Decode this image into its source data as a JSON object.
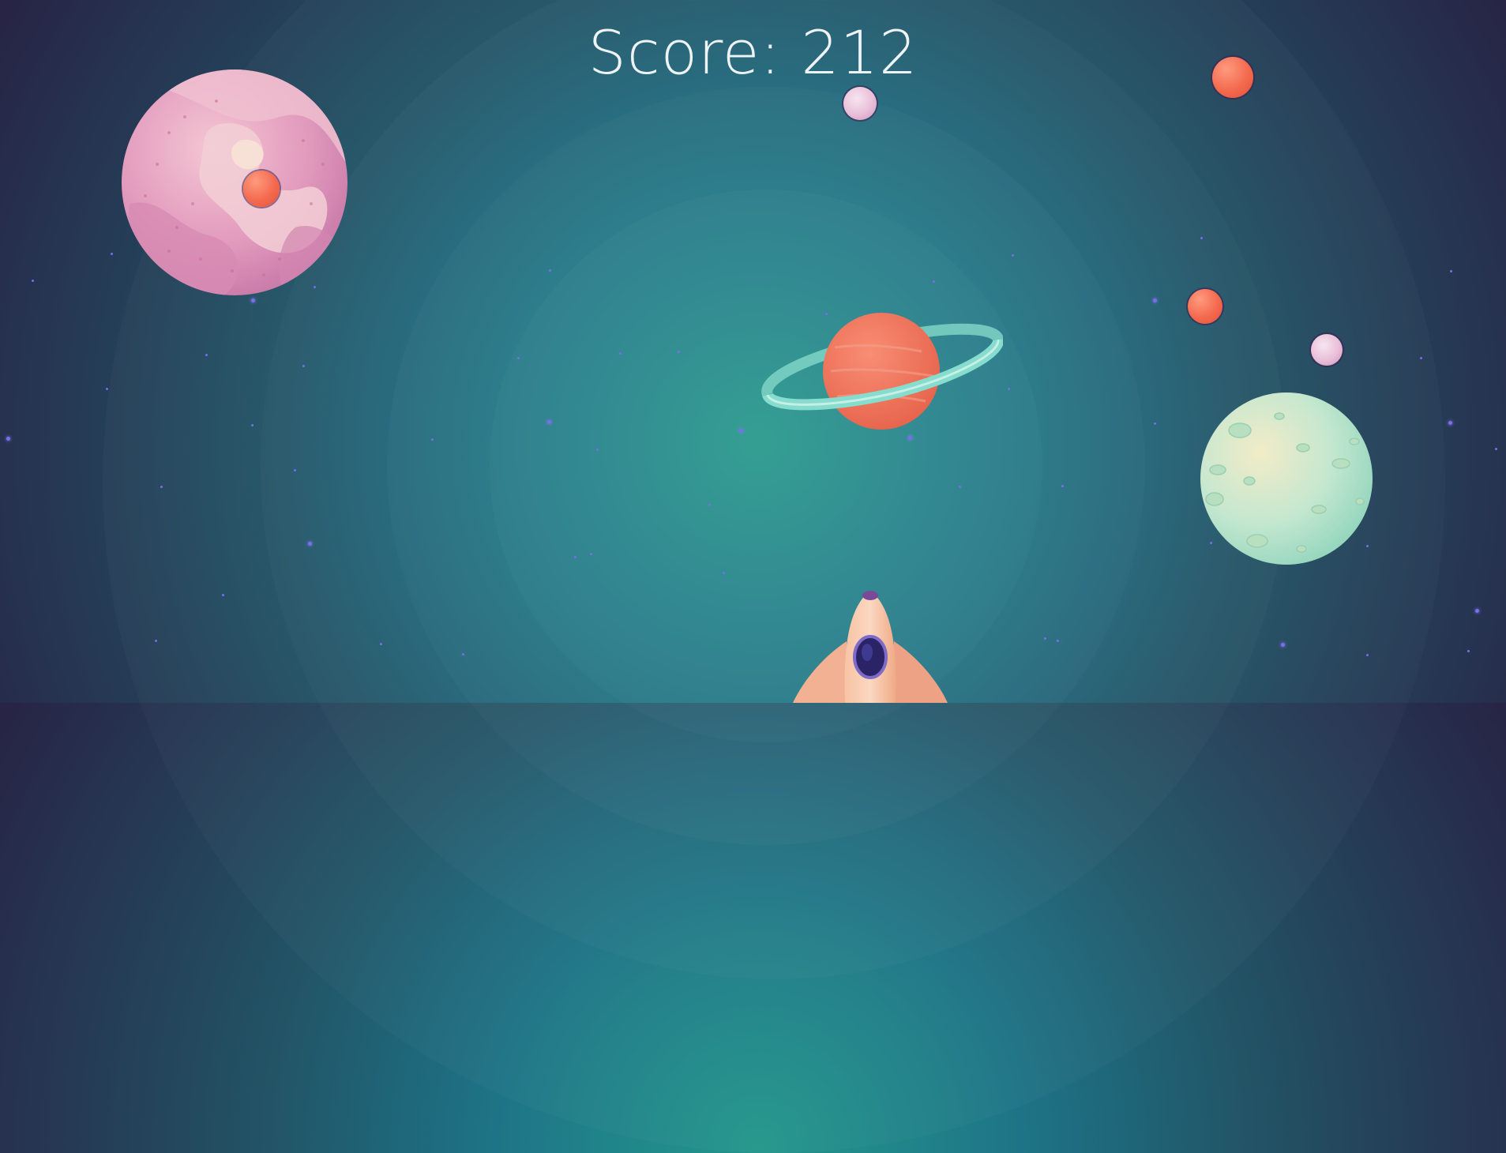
{
  "hud": {
    "score_label": "Score: 212"
  },
  "colors": {
    "background_center": "#23978b",
    "background_edge": "#272445",
    "score_text": "#eef3f6",
    "star": "#7b6cf0",
    "red_orb": "#f46a4f",
    "pink_orb": "#e9bfd8"
  },
  "icons": {
    "player": "rocket-ship",
    "planets": [
      "pink-marbled-planet",
      "ringed-orange-planet",
      "mint-cratered-planet"
    ],
    "orbs": [
      "red-orb",
      "pink-orb"
    ]
  }
}
